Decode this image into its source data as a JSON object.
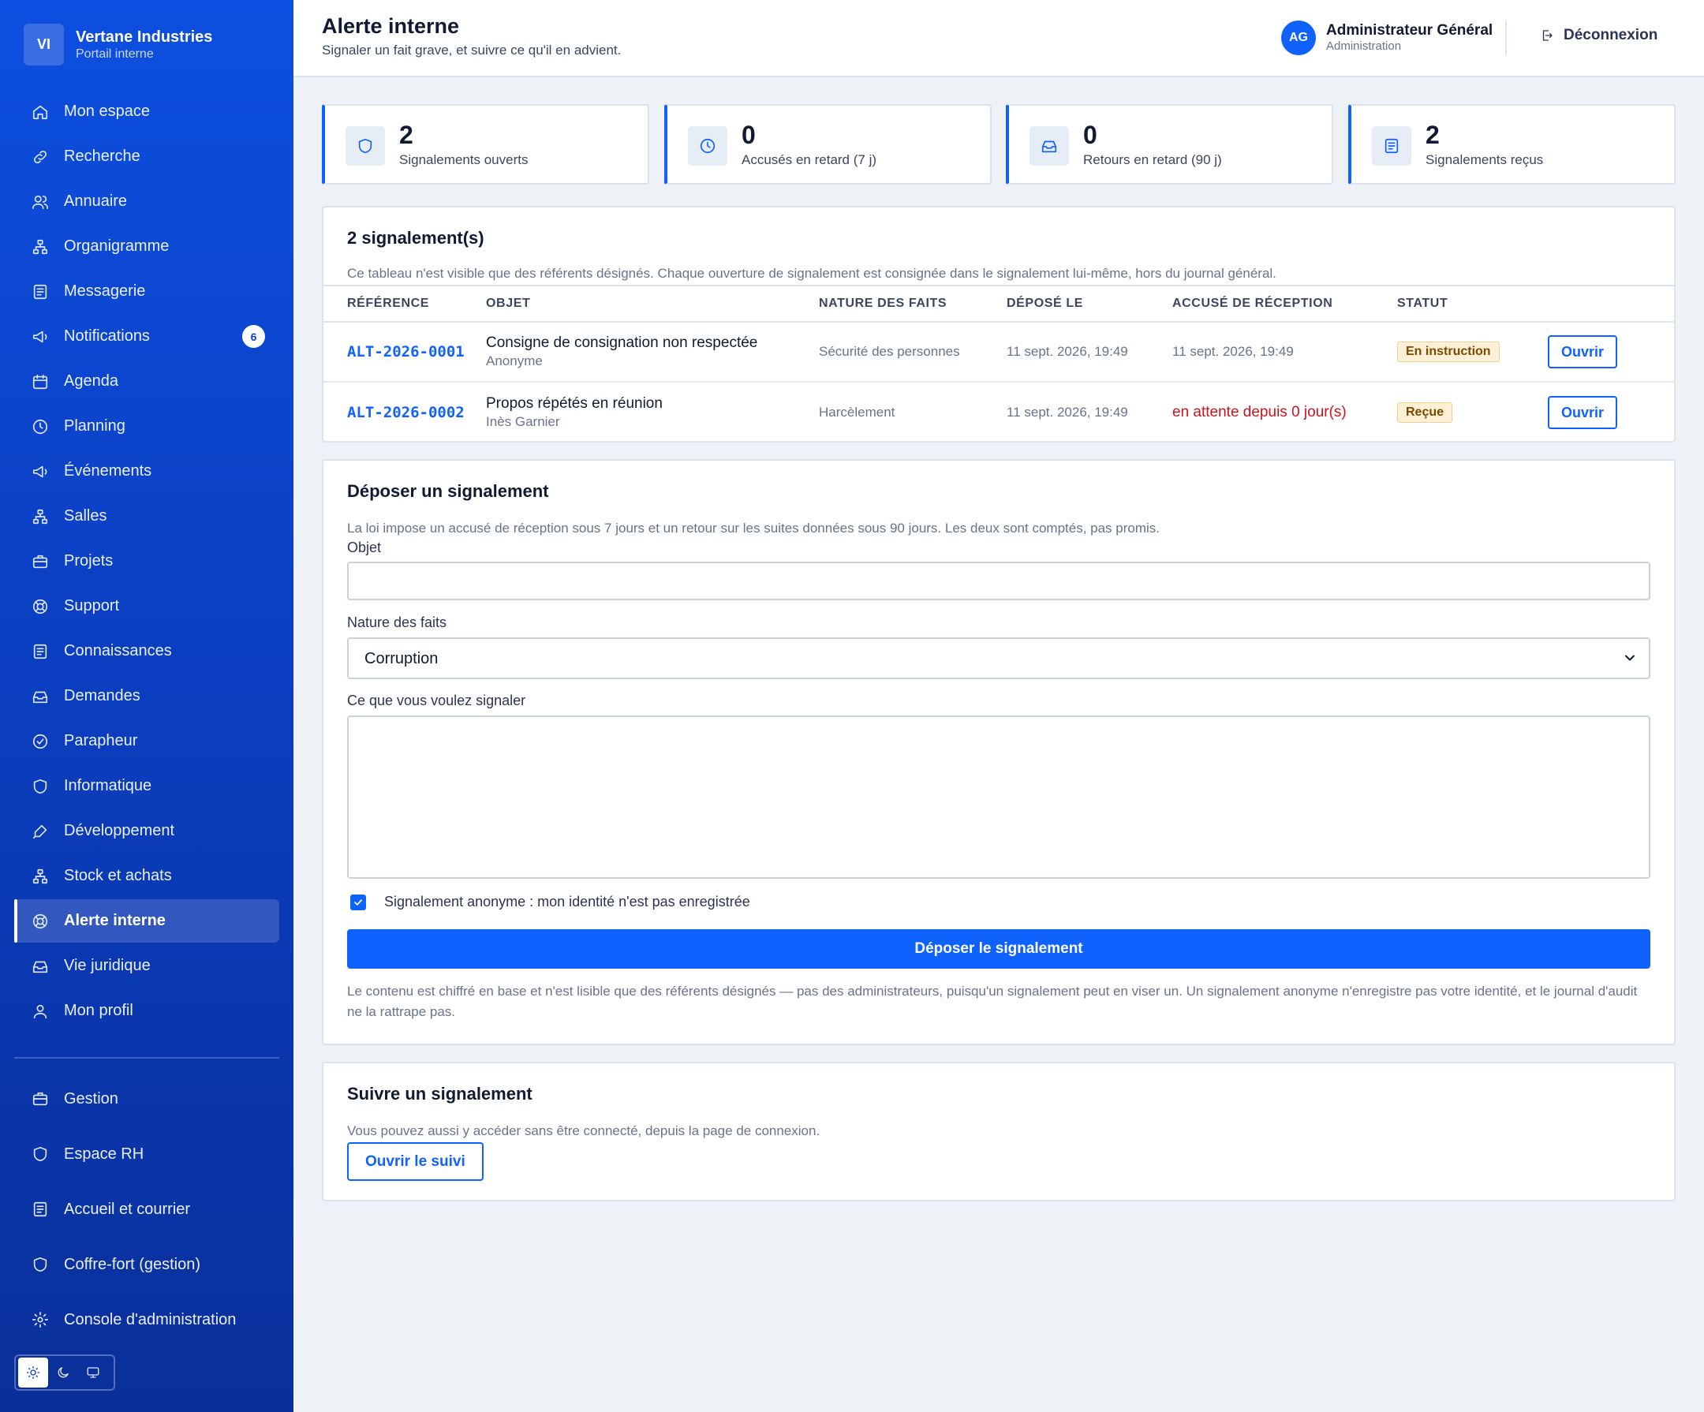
{
  "brand": {
    "logo": "VI",
    "name": "Vertane Industries",
    "subtitle": "Portail interne"
  },
  "sidebar": {
    "items": [
      {
        "label": "Mon espace",
        "icon": "home-icon"
      },
      {
        "label": "Recherche",
        "icon": "link-icon"
      },
      {
        "label": "Annuaire",
        "icon": "users-icon"
      },
      {
        "label": "Organigramme",
        "icon": "org-chart-icon"
      },
      {
        "label": "Messagerie",
        "icon": "message-icon"
      },
      {
        "label": "Notifications",
        "icon": "megaphone-icon",
        "badge": "6"
      },
      {
        "label": "Agenda",
        "icon": "calendar-icon"
      },
      {
        "label": "Planning",
        "icon": "clock-icon"
      },
      {
        "label": "Événements",
        "icon": "megaphone-icon"
      },
      {
        "label": "Salles",
        "icon": "org-chart-icon"
      },
      {
        "label": "Projets",
        "icon": "briefcase-icon"
      },
      {
        "label": "Support",
        "icon": "lifebuoy-icon"
      },
      {
        "label": "Connaissances",
        "icon": "document-icon"
      },
      {
        "label": "Demandes",
        "icon": "inbox-icon"
      },
      {
        "label": "Parapheur",
        "icon": "check-circle-icon"
      },
      {
        "label": "Informatique",
        "icon": "shield-icon"
      },
      {
        "label": "Développement",
        "icon": "pen-icon"
      },
      {
        "label": "Stock et achats",
        "icon": "org-chart-icon"
      },
      {
        "label": "Alerte interne",
        "icon": "lifebuoy-icon",
        "active": true
      },
      {
        "label": "Vie juridique",
        "icon": "inbox-icon"
      },
      {
        "label": "Mon profil",
        "icon": "user-icon"
      }
    ],
    "admin_items": [
      {
        "label": "Gestion",
        "icon": "briefcase-icon"
      },
      {
        "label": "Espace RH",
        "icon": "shield-icon"
      },
      {
        "label": "Accueil et courrier",
        "icon": "document-icon"
      },
      {
        "label": "Coffre-fort (gestion)",
        "icon": "shield-icon"
      },
      {
        "label": "Console d'administration",
        "icon": "gear-icon"
      }
    ]
  },
  "header": {
    "title": "Alerte interne",
    "subtitle": "Signaler un fait grave, et suivre ce qu'il en advient.",
    "user": {
      "initials": "AG",
      "name": "Administrateur Général",
      "role": "Administration"
    },
    "logout_label": "Déconnexion"
  },
  "stats": [
    {
      "value": "2",
      "label": "Signalements ouverts",
      "icon": "shield-icon"
    },
    {
      "value": "0",
      "label": "Accusés en retard (7 j)",
      "icon": "clock-icon"
    },
    {
      "value": "0",
      "label": "Retours en retard (90 j)",
      "icon": "inbox-icon"
    },
    {
      "value": "2",
      "label": "Signalements reçus",
      "icon": "document-icon"
    }
  ],
  "reports": {
    "title": "2 signalement(s)",
    "description": "Ce tableau n'est visible que des référents désignés. Chaque ouverture de signalement est consignée dans le signalement lui-même, hors du journal général.",
    "columns": [
      "RÉFÉRENCE",
      "OBJET",
      "NATURE DES FAITS",
      "DÉPOSÉ LE",
      "ACCUSÉ DE RÉCEPTION",
      "STATUT"
    ],
    "rows": [
      {
        "ref": "ALT-2026-0001",
        "subject": "Consigne de consignation non respectée",
        "author": "Anonyme",
        "nature": "Sécurité des personnes",
        "filed": "11 sept. 2026, 19:49",
        "ack": "11 sept. 2026, 19:49",
        "status": "En instruction",
        "action": "Ouvrir"
      },
      {
        "ref": "ALT-2026-0002",
        "subject": "Propos répétés en réunion",
        "author": "Inès Garnier",
        "nature": "Harcèlement",
        "filed": "11 sept. 2026, 19:49",
        "ack": "en attente depuis 0 jour(s)",
        "status": "Reçue",
        "action": "Ouvrir"
      }
    ]
  },
  "form": {
    "title": "Déposer un signalement",
    "description": "La loi impose un accusé de réception sous 7 jours et un retour sur les suites données sous 90 jours. Les deux sont comptés, pas promis.",
    "subject_label": "Objet",
    "subject_value": "",
    "nature_label": "Nature des faits",
    "nature_value": "Corruption",
    "body_label": "Ce que vous voulez signaler",
    "body_value": "",
    "anonymous_label": "Signalement anonyme : mon identité n'est pas enregistrée",
    "anonymous_checked": true,
    "submit_label": "Déposer le signalement",
    "note": "Le contenu est chiffré en base et n'est lisible que des référents désignés — pas des administrateurs, puisqu'un signalement peut en viser un. Un signalement anonyme n'enregistre pas votre identité, et le journal d'audit ne la rattrape pas."
  },
  "follow": {
    "title": "Suivre un signalement",
    "description": "Vous pouvez aussi y accéder sans être connecté, depuis la page de connexion.",
    "button_label": "Ouvrir le suivi"
  },
  "colors": {
    "accent": "#0f62fe",
    "sidebar": "#0b3fc2",
    "danger": "#d0121e",
    "status_bg": "#fdf0d6"
  }
}
